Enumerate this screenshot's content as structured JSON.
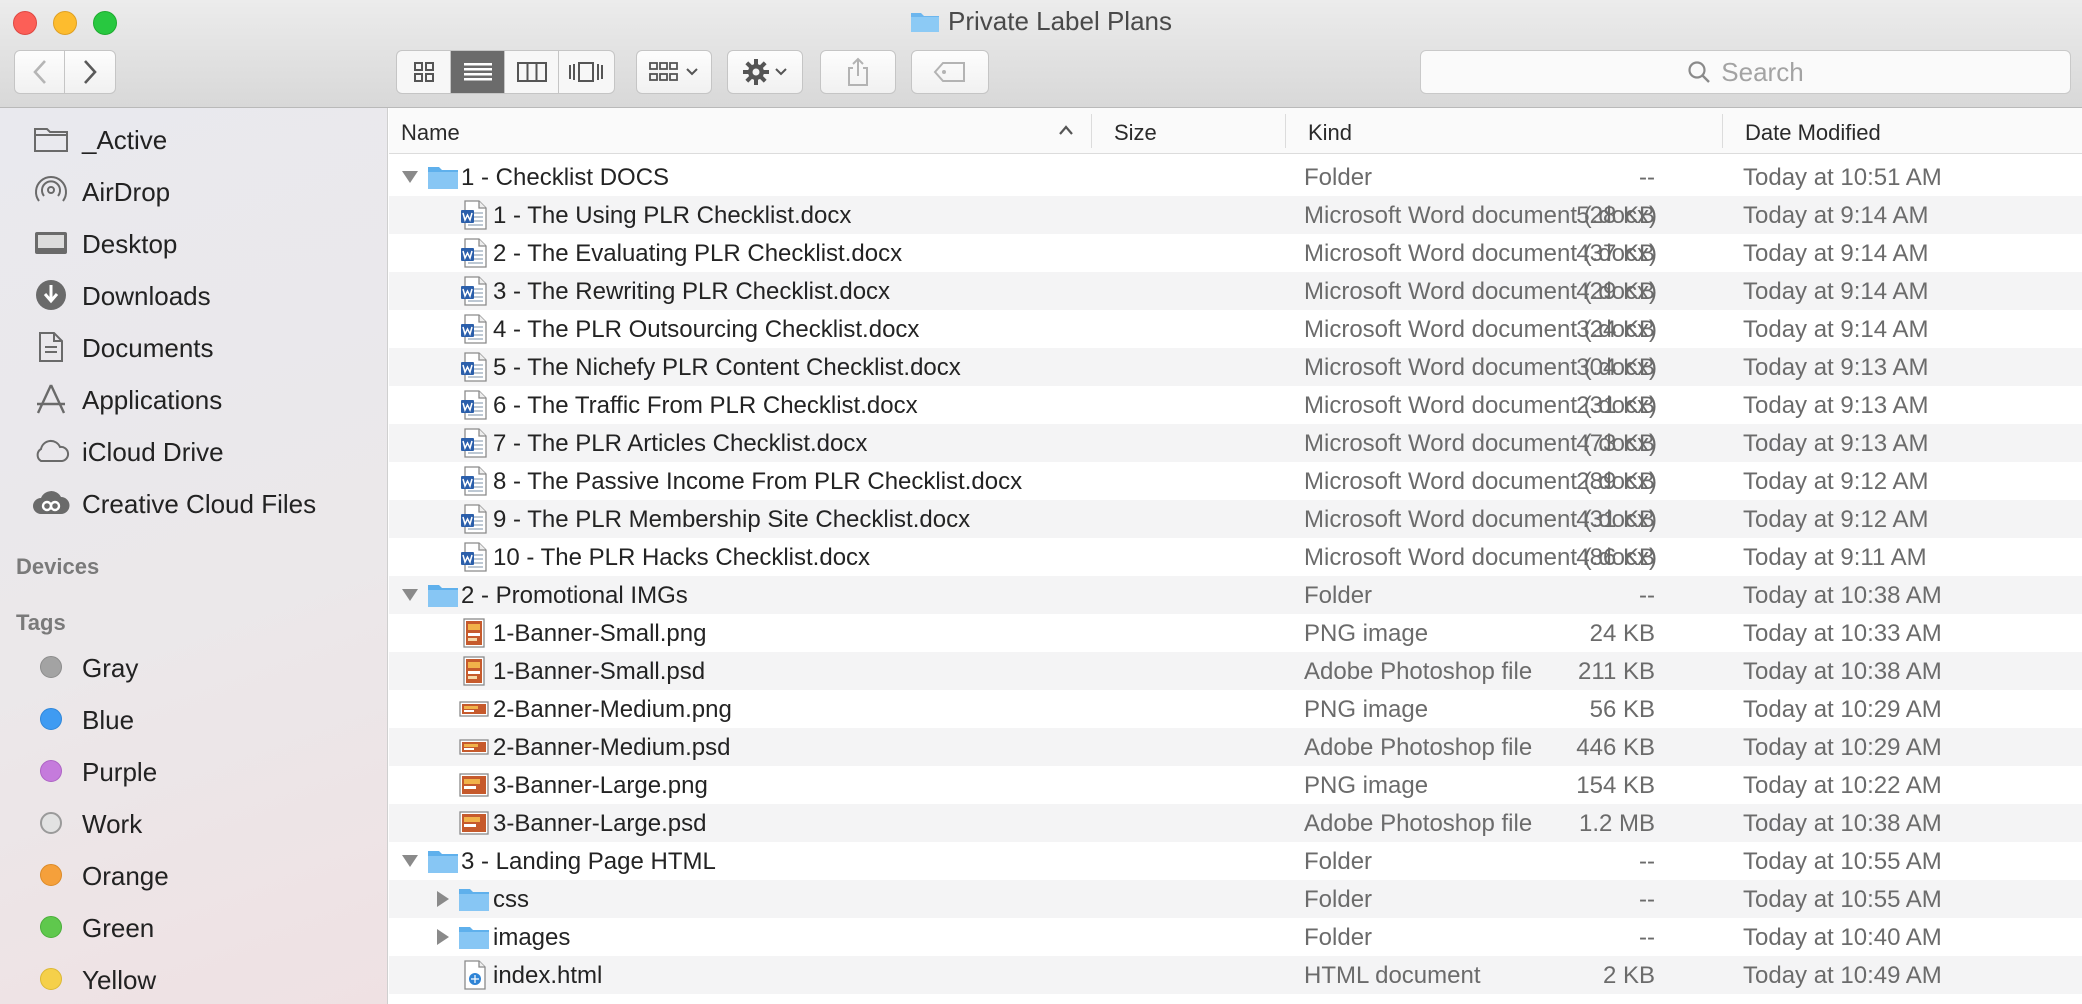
{
  "window": {
    "title": "Private Label Plans",
    "traffic_lights": [
      "close",
      "minimize",
      "zoom"
    ]
  },
  "toolbar": {
    "back_icon": "chevron-left-icon",
    "forward_icon": "chevron-right-icon",
    "view_modes": [
      "icon-view",
      "list-view",
      "column-view",
      "cover-flow-view"
    ],
    "active_view": "list-view",
    "arrange_icon": "arrange-grid-icon",
    "action_icon": "gear-icon",
    "share_icon": "share-icon",
    "tag_icon": "tag-icon",
    "search_placeholder": "Search"
  },
  "sidebar": {
    "favorites": [
      {
        "label": "_Active",
        "icon": "folder-icon"
      },
      {
        "label": "AirDrop",
        "icon": "airdrop-icon"
      },
      {
        "label": "Desktop",
        "icon": "desktop-icon"
      },
      {
        "label": "Downloads",
        "icon": "downloads-icon"
      },
      {
        "label": "Documents",
        "icon": "documents-icon"
      },
      {
        "label": "Applications",
        "icon": "applications-icon"
      },
      {
        "label": "iCloud Drive",
        "icon": "cloud-icon"
      },
      {
        "label": "Creative Cloud Files",
        "icon": "creative-cloud-icon"
      }
    ],
    "devices_header": "Devices",
    "tags_header": "Tags",
    "tags": [
      {
        "label": "Gray",
        "color": "#a3a3a3"
      },
      {
        "label": "Blue",
        "color": "#3f9bf2"
      },
      {
        "label": "Purple",
        "color": "#c57bdc"
      },
      {
        "label": "Work",
        "color": "#e2e2e2"
      },
      {
        "label": "Orange",
        "color": "#f5a03b"
      },
      {
        "label": "Green",
        "color": "#5fc84d"
      },
      {
        "label": "Yellow",
        "color": "#f5d04a"
      }
    ]
  },
  "columns": {
    "name": "Name",
    "size": "Size",
    "kind": "Kind",
    "date": "Date Modified",
    "sort_indicator": "sort-ascending-icon"
  },
  "rows": [
    {
      "name": "1 - Checklist DOCS",
      "size": "--",
      "kind": "Folder",
      "date": "Today at 10:51 AM",
      "level": 0,
      "type": "folder",
      "disclosure": "expanded"
    },
    {
      "name": "1 - The Using PLR Checklist.docx",
      "size": "528 KB",
      "kind": "Microsoft Word document (.docx)",
      "date": "Today at 9:14 AM",
      "level": 1,
      "type": "docx"
    },
    {
      "name": "2 - The Evaluating PLR Checklist.docx",
      "size": "437 KB",
      "kind": "Microsoft Word document (.docx)",
      "date": "Today at 9:14 AM",
      "level": 1,
      "type": "docx"
    },
    {
      "name": "3 - The Rewriting PLR Checklist.docx",
      "size": "429 KB",
      "kind": "Microsoft Word document (.docx)",
      "date": "Today at 9:14 AM",
      "level": 1,
      "type": "docx"
    },
    {
      "name": "4 - The PLR Outsourcing Checklist.docx",
      "size": "324 KB",
      "kind": "Microsoft Word document (.docx)",
      "date": "Today at 9:14 AM",
      "level": 1,
      "type": "docx"
    },
    {
      "name": "5 - The Nichefy PLR Content Checklist.docx",
      "size": "304 KB",
      "kind": "Microsoft Word document (.docx)",
      "date": "Today at 9:13 AM",
      "level": 1,
      "type": "docx"
    },
    {
      "name": "6 - The Traffic From PLR Checklist.docx",
      "size": "231 KB",
      "kind": "Microsoft Word document (.docx)",
      "date": "Today at 9:13 AM",
      "level": 1,
      "type": "docx"
    },
    {
      "name": "7 - The PLR Articles Checklist.docx",
      "size": "473 KB",
      "kind": "Microsoft Word document (.docx)",
      "date": "Today at 9:13 AM",
      "level": 1,
      "type": "docx"
    },
    {
      "name": "8 - The Passive Income From PLR Checklist.docx",
      "size": "289 KB",
      "kind": "Microsoft Word document (.docx)",
      "date": "Today at 9:12 AM",
      "level": 1,
      "type": "docx"
    },
    {
      "name": "9 - The PLR Membership Site Checklist.docx",
      "size": "431 KB",
      "kind": "Microsoft Word document (.docx)",
      "date": "Today at 9:12 AM",
      "level": 1,
      "type": "docx"
    },
    {
      "name": "10 - The PLR Hacks Checklist.docx",
      "size": "486 KB",
      "kind": "Microsoft Word document (.docx)",
      "date": "Today at 9:11 AM",
      "level": 1,
      "type": "docx"
    },
    {
      "name": "2 - Promotional IMGs",
      "size": "--",
      "kind": "Folder",
      "date": "Today at 10:38 AM",
      "level": 0,
      "type": "folder",
      "disclosure": "expanded"
    },
    {
      "name": "1-Banner-Small.png",
      "size": "24 KB",
      "kind": "PNG image",
      "date": "Today at 10:33 AM",
      "level": 1,
      "type": "image-portrait"
    },
    {
      "name": "1-Banner-Small.psd",
      "size": "211 KB",
      "kind": "Adobe Photoshop file",
      "date": "Today at 10:38 AM",
      "level": 1,
      "type": "image-portrait"
    },
    {
      "name": "2-Banner-Medium.png",
      "size": "56 KB",
      "kind": "PNG image",
      "date": "Today at 10:29 AM",
      "level": 1,
      "type": "image-wide"
    },
    {
      "name": "2-Banner-Medium.psd",
      "size": "446 KB",
      "kind": "Adobe Photoshop file",
      "date": "Today at 10:29 AM",
      "level": 1,
      "type": "image-wide"
    },
    {
      "name": "3-Banner-Large.png",
      "size": "154 KB",
      "kind": "PNG image",
      "date": "Today at 10:22 AM",
      "level": 1,
      "type": "image-landscape"
    },
    {
      "name": "3-Banner-Large.psd",
      "size": "1.2 MB",
      "kind": "Adobe Photoshop file",
      "date": "Today at 10:38 AM",
      "level": 1,
      "type": "image-landscape"
    },
    {
      "name": "3 - Landing Page HTML",
      "size": "--",
      "kind": "Folder",
      "date": "Today at 10:55 AM",
      "level": 0,
      "type": "folder",
      "disclosure": "expanded"
    },
    {
      "name": "css",
      "size": "--",
      "kind": "Folder",
      "date": "Today at 10:55 AM",
      "level": 1,
      "type": "folder",
      "disclosure": "collapsed"
    },
    {
      "name": "images",
      "size": "--",
      "kind": "Folder",
      "date": "Today at 10:40 AM",
      "level": 1,
      "type": "folder",
      "disclosure": "collapsed"
    },
    {
      "name": "index.html",
      "size": "2 KB",
      "kind": "HTML document",
      "date": "Today at 10:49 AM",
      "level": 1,
      "type": "html"
    }
  ]
}
